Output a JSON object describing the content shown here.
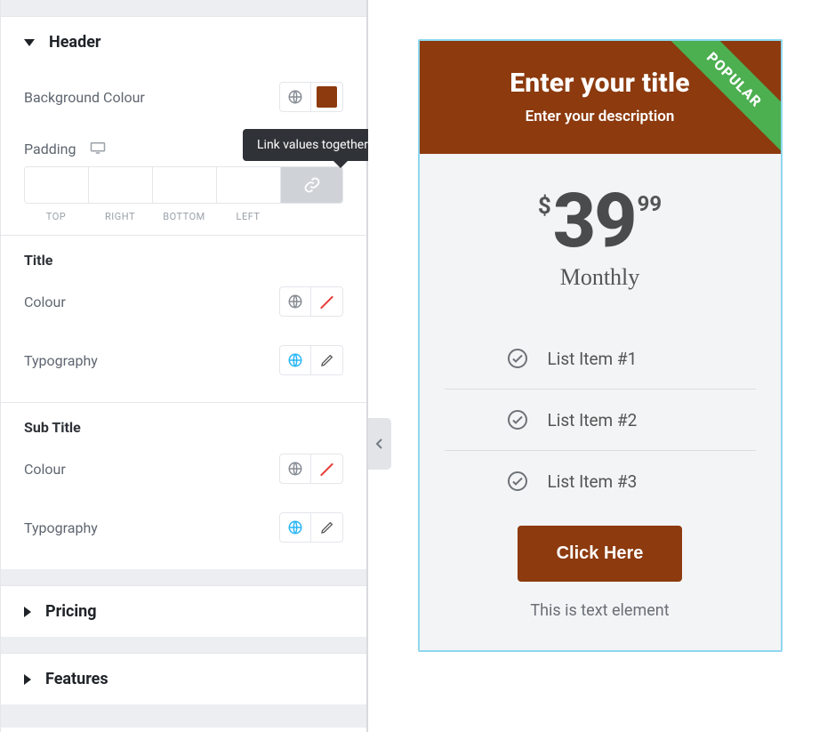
{
  "panel": {
    "sections": {
      "header": {
        "title": "Header",
        "background_colour_label": "Background Colour",
        "background_colour_value": "#8c3a0e",
        "padding_label": "Padding",
        "padding_side_labels": [
          "TOP",
          "RIGHT",
          "BOTTOM",
          "LEFT"
        ],
        "link_tooltip": "Link values together",
        "title_group": {
          "heading": "Title",
          "colour_label": "Colour",
          "typography_label": "Typography"
        },
        "subtitle_group": {
          "heading": "Sub Title",
          "colour_label": "Colour",
          "typography_label": "Typography"
        }
      },
      "pricing": {
        "title": "Pricing"
      },
      "features": {
        "title": "Features"
      }
    }
  },
  "preview": {
    "badge": "POPULAR",
    "title": "Enter your title",
    "subtitle": "Enter your description",
    "currency": "$",
    "amount": "39",
    "decimals": "99",
    "period": "Monthly",
    "features": [
      "List Item #1",
      "List Item #2",
      "List Item #3"
    ],
    "cta": "Click Here",
    "under_cta": "This is text element"
  },
  "colors": {
    "brand": "#8c3a0e",
    "badge": "#4CAF50",
    "card_outline": "#8fd7ef"
  }
}
